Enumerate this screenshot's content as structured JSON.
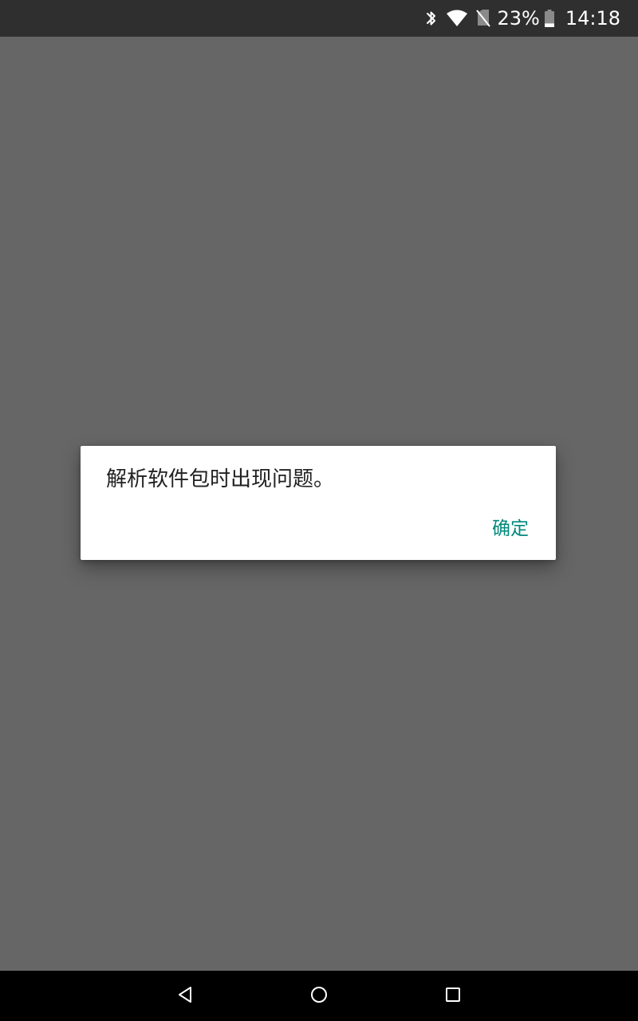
{
  "status_bar": {
    "icons": [
      "bluetooth-icon",
      "wifi-icon",
      "no-sim-icon",
      "battery-icon"
    ],
    "battery_percent": "23%",
    "battery_level": 0.23,
    "time": "14:18"
  },
  "dialog": {
    "message": "解析软件包时出现问题。",
    "ok_label": "确定"
  },
  "nav_bar": {
    "icons": [
      "back-icon",
      "home-icon",
      "recents-icon"
    ]
  },
  "colors": {
    "status_bar_bg": "#2f2f2f",
    "scrim_bg": "#666666",
    "dialog_bg": "#ffffff",
    "accent": "#00897b",
    "nav_bar_bg": "#000000"
  }
}
